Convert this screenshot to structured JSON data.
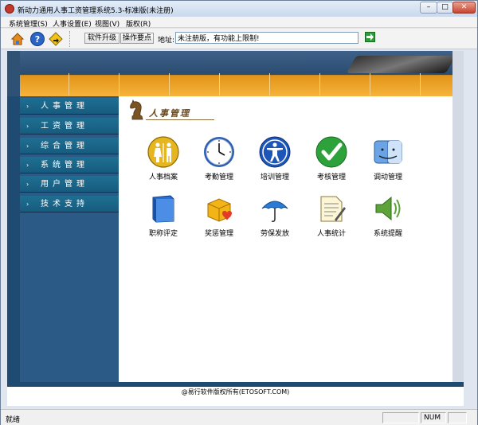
{
  "window": {
    "title": "新动力通用人事工资管理系统5.3-标准版(未注册)",
    "min_label": "–",
    "max_label": "□",
    "close_label": "✕"
  },
  "menubar": {
    "items": [
      "系统管理(S)",
      "人事设置(E)",
      "视图(V)",
      "版权(R)"
    ]
  },
  "toolbar": {
    "icons": [
      "home-icon",
      "help-icon",
      "exit-icon"
    ],
    "upgrade_label": "软件升级",
    "tips_label": "操作要点",
    "address_label": "地址:",
    "address_value": "未注册版，有功能上限制!"
  },
  "sidebar": {
    "items": [
      {
        "arrow": "›",
        "label": "人事管理"
      },
      {
        "arrow": "›",
        "label": "工资管理"
      },
      {
        "arrow": "›",
        "label": "综合管理"
      },
      {
        "arrow": "›",
        "label": "系统管理"
      },
      {
        "arrow": "›",
        "label": "用户管理"
      },
      {
        "arrow": "›",
        "label": "技术支持"
      }
    ]
  },
  "main": {
    "section_title": "人事管理",
    "modules": [
      {
        "label": "人事档案",
        "icon": "restroom-icon"
      },
      {
        "label": "考勤管理",
        "icon": "clock-icon"
      },
      {
        "label": "培训管理",
        "icon": "accessibility-icon"
      },
      {
        "label": "考核管理",
        "icon": "checkmark-icon"
      },
      {
        "label": "调动管理",
        "icon": "finder-icon"
      },
      {
        "label": "职称评定",
        "icon": "book-icon"
      },
      {
        "label": "奖惩管理",
        "icon": "gift-icon"
      },
      {
        "label": "劳保发放",
        "icon": "umbrella-icon"
      },
      {
        "label": "人事统计",
        "icon": "document-icon"
      },
      {
        "label": "系统提醒",
        "icon": "speaker-icon"
      }
    ]
  },
  "footer": {
    "copyright": "@易行软件版权所有(ETOSOFT.COM)"
  },
  "statusbar": {
    "text": "就绪",
    "num": "NUM"
  },
  "colors": {
    "sidebar": "#2b5a86",
    "banner_orange": "#f6b33c",
    "accent_green": "#2e9d39"
  }
}
